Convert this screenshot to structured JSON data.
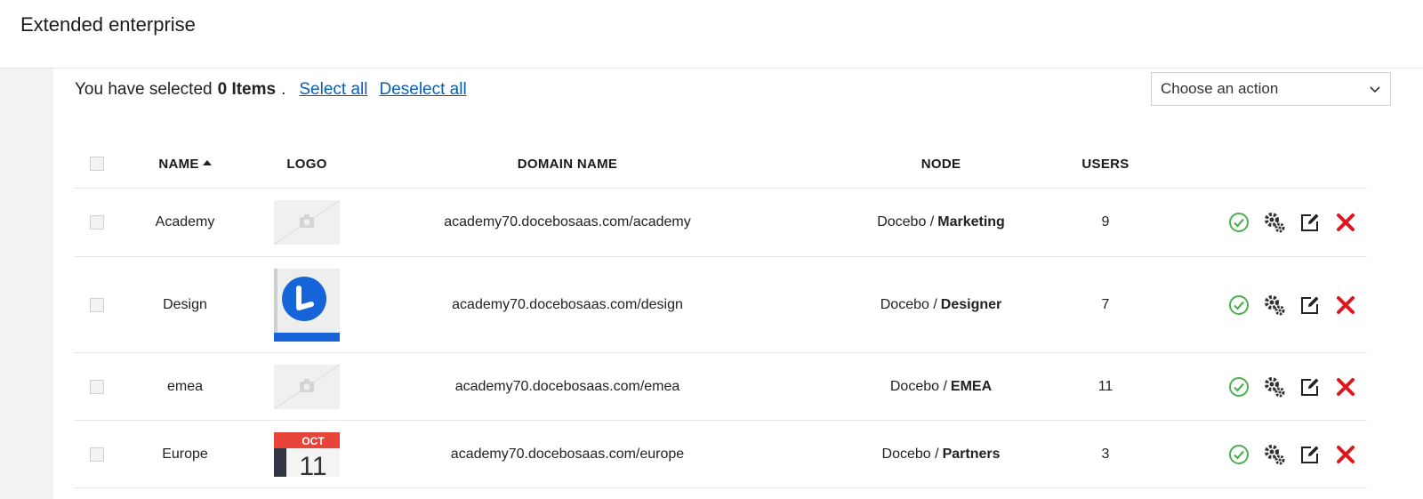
{
  "header": {
    "title": "Extended enterprise"
  },
  "selection": {
    "prefix": "You have selected",
    "count": "0 Items",
    "suffix": ".",
    "select_all": "Select all",
    "deselect_all": "Deselect all"
  },
  "action_select": {
    "value": "Choose an action"
  },
  "table": {
    "columns": {
      "name": "NAME",
      "logo": "LOGO",
      "domain": "DOMAIN NAME",
      "node": "NODE",
      "users": "USERS"
    },
    "rows": [
      {
        "name": "Academy",
        "logo": "placeholder-camera",
        "domain": "academy70.docebosaas.com/academy",
        "node_root": "Docebo /",
        "node_leaf": "Marketing",
        "users": "9"
      },
      {
        "name": "Design",
        "logo": "brand-logo-l",
        "domain": "academy70.docebosaas.com/design",
        "node_root": "Docebo /",
        "node_leaf": "Designer",
        "users": "7"
      },
      {
        "name": "emea",
        "logo": "placeholder-camera",
        "domain": "academy70.docebosaas.com/emea",
        "node_root": "Docebo /",
        "node_leaf": "EMEA",
        "users": "11"
      },
      {
        "name": "Europe",
        "logo": "calendar",
        "logo_text_month": "OCT",
        "logo_text_day": "11",
        "domain": "academy70.docebosaas.com/europe",
        "node_root": "Docebo /",
        "node_leaf": "Partners",
        "users": "3"
      }
    ]
  },
  "colors": {
    "link": "#0a5fb4",
    "active_green": "#4cb050",
    "delete_red": "#e0161e",
    "brand_blue": "#1565d8"
  },
  "icons": [
    "check-circle-icon",
    "gears-icon",
    "edit-icon",
    "delete-icon",
    "camera-icon",
    "sort-asc-icon",
    "chevron-down-icon"
  ]
}
